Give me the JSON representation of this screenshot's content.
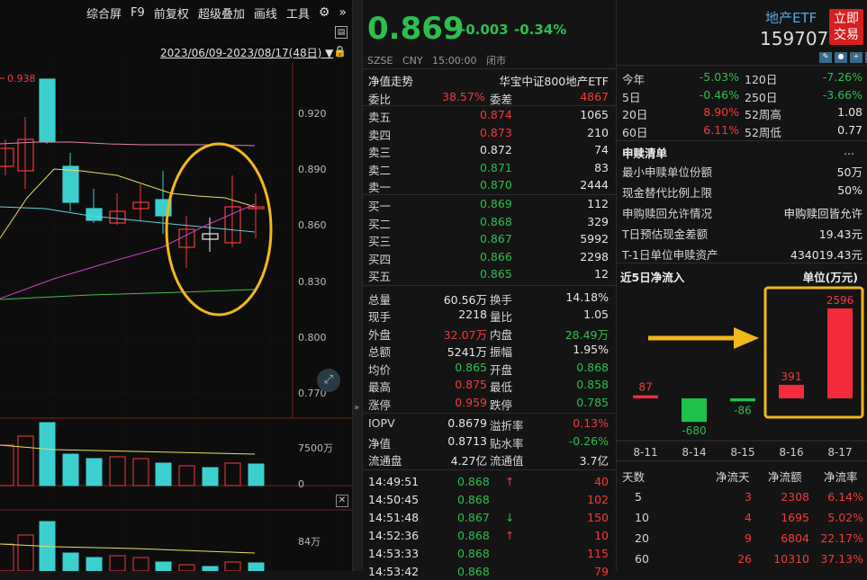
{
  "toolbar": {
    "items": [
      "综合屏",
      "F9",
      "前复权",
      "超级叠加",
      "画线",
      "工具"
    ],
    "date_range": "2023/06/09-2023/08/17(48日)"
  },
  "kline": {
    "high_label": "0.938",
    "y_ticks": [
      "0.920",
      "0.890",
      "0.860",
      "0.830",
      "0.800",
      "0.770"
    ],
    "vol_tick": "7500万",
    "vol_zero": "0",
    "vol2_tick": "84万"
  },
  "header": {
    "price": "0.869",
    "change": "-0.003",
    "change_pct": "-0.34%",
    "name": "地产ETF",
    "code": "159707",
    "trade_btn": "立即交易",
    "sub": "SZSE   CNY   15:00:00   闭市"
  },
  "mid": {
    "tab1": "净值走势",
    "tab2": "华宝中证800地产ETF",
    "weibi": {
      "l1": "委比",
      "v1": "38.57%",
      "l2": "委差",
      "v2": "4867"
    },
    "asks": [
      {
        "label": "卖五",
        "price": "0.874",
        "vol": "1065"
      },
      {
        "label": "卖四",
        "price": "0.873",
        "vol": "210"
      },
      {
        "label": "卖三",
        "price": "0.872",
        "vol": "74"
      },
      {
        "label": "卖二",
        "price": "0.871",
        "vol": "83"
      },
      {
        "label": "卖一",
        "price": "0.870",
        "vol": "2444"
      }
    ],
    "bids": [
      {
        "label": "买一",
        "price": "0.869",
        "vol": "112"
      },
      {
        "label": "买二",
        "price": "0.868",
        "vol": "329"
      },
      {
        "label": "买三",
        "price": "0.867",
        "vol": "5992"
      },
      {
        "label": "买四",
        "price": "0.866",
        "vol": "2298"
      },
      {
        "label": "买五",
        "price": "0.865",
        "vol": "12"
      }
    ],
    "stats": [
      {
        "l1": "总量",
        "v1": "60.56万",
        "c1": "wh",
        "l2": "换手",
        "v2": "14.18%",
        "c2": "wh"
      },
      {
        "l1": "现手",
        "v1": "2218",
        "c1": "wh",
        "l2": "量比",
        "v2": "1.05",
        "c2": "wh"
      },
      {
        "l1": "外盘",
        "v1": "32.07万",
        "c1": "up",
        "l2": "内盘",
        "v2": "28.49万",
        "c2": "dn"
      },
      {
        "l1": "总额",
        "v1": "5241万",
        "c1": "wh",
        "l2": "振幅",
        "v2": "1.95%",
        "c2": "wh"
      },
      {
        "l1": "均价",
        "v1": "0.865",
        "c1": "dn",
        "l2": "开盘",
        "v2": "0.868",
        "c2": "dn"
      },
      {
        "l1": "最高",
        "v1": "0.875",
        "c1": "up",
        "l2": "最低",
        "v2": "0.858",
        "c2": "dn"
      },
      {
        "l1": "涨停",
        "v1": "0.959",
        "c1": "up",
        "l2": "跌停",
        "v2": "0.785",
        "c2": "dn"
      }
    ],
    "iopv": [
      {
        "l1": "IOPV",
        "v1": "0.8679",
        "c1": "wh",
        "l2": "溢折率",
        "v2": "0.13%",
        "c2": "up"
      },
      {
        "l1": "净值",
        "v1": "0.8713",
        "c1": "wh",
        "l2": "贴水率",
        "v2": "-0.26%",
        "c2": "dn"
      },
      {
        "l1": "流通盘",
        "v1": "4.27亿",
        "c1": "wh",
        "l2": "流通值",
        "v2": "3.7亿",
        "c2": "wh"
      }
    ],
    "ticks": [
      {
        "time": "14:49:51",
        "price": "0.868",
        "arrow": "↑",
        "ac": "up",
        "vol": "40"
      },
      {
        "time": "14:50:45",
        "price": "0.868",
        "arrow": "",
        "ac": "",
        "vol": "102"
      },
      {
        "time": "14:51:48",
        "price": "0.867",
        "arrow": "↓",
        "ac": "dn",
        "vol": "150"
      },
      {
        "time": "14:52:36",
        "price": "0.868",
        "arrow": "↑",
        "ac": "up",
        "vol": "10"
      },
      {
        "time": "14:53:33",
        "price": "0.868",
        "arrow": "",
        "ac": "",
        "vol": "115"
      },
      {
        "time": "14:53:42",
        "price": "0.868",
        "arrow": "",
        "ac": "",
        "vol": "79"
      }
    ]
  },
  "right": {
    "perf": [
      {
        "l1": "今年",
        "v1": "-5.03%",
        "c1": "dn",
        "l2": "120日",
        "v2": "-7.26%",
        "c2": "dn"
      },
      {
        "l1": "5日",
        "v1": "-0.46%",
        "c1": "dn",
        "l2": "250日",
        "v2": "-3.66%",
        "c2": "dn"
      },
      {
        "l1": "20日",
        "v1": "8.90%",
        "c1": "up",
        "l2": "52周高",
        "v2": "1.08",
        "c2": "wh"
      },
      {
        "l1": "60日",
        "v1": "6.11%",
        "c1": "up",
        "l2": "52周低",
        "v2": "0.77",
        "c2": "wh"
      }
    ],
    "sg_title": "申赎清单",
    "sg_more": "...",
    "sg": [
      {
        "k": "最小申赎单位份额",
        "v": "50万"
      },
      {
        "k": "现金替代比例上限",
        "v": "50%"
      },
      {
        "k": "申购赎回允许情况",
        "v": "申购赎回皆允许"
      },
      {
        "k": "T日预估现金差额",
        "v": "19.43元"
      },
      {
        "k": "T-1日单位申赎资产",
        "v": "434019.43元"
      }
    ],
    "flow_title": "近5日净流入",
    "flow_unit": "单位(万元)",
    "flow_table_head": [
      "天数",
      "净流天",
      "净流额",
      "净流率"
    ],
    "flow_table": [
      {
        "d": "5",
        "n": "3",
        "amt": "2308",
        "rate": "6.14%"
      },
      {
        "d": "10",
        "n": "4",
        "amt": "1695",
        "rate": "5.02%"
      },
      {
        "d": "20",
        "n": "9",
        "amt": "6804",
        "rate": "22.17%"
      },
      {
        "d": "60",
        "n": "26",
        "amt": "10310",
        "rate": "37.13%"
      }
    ]
  },
  "chart_data": {
    "type": "bar",
    "title": "近5日净流入",
    "ylabel": "单位(万元)",
    "categories": [
      "8-11",
      "8-14",
      "8-15",
      "8-16",
      "8-17"
    ],
    "values": [
      87,
      -680,
      -86,
      391,
      2596
    ]
  }
}
